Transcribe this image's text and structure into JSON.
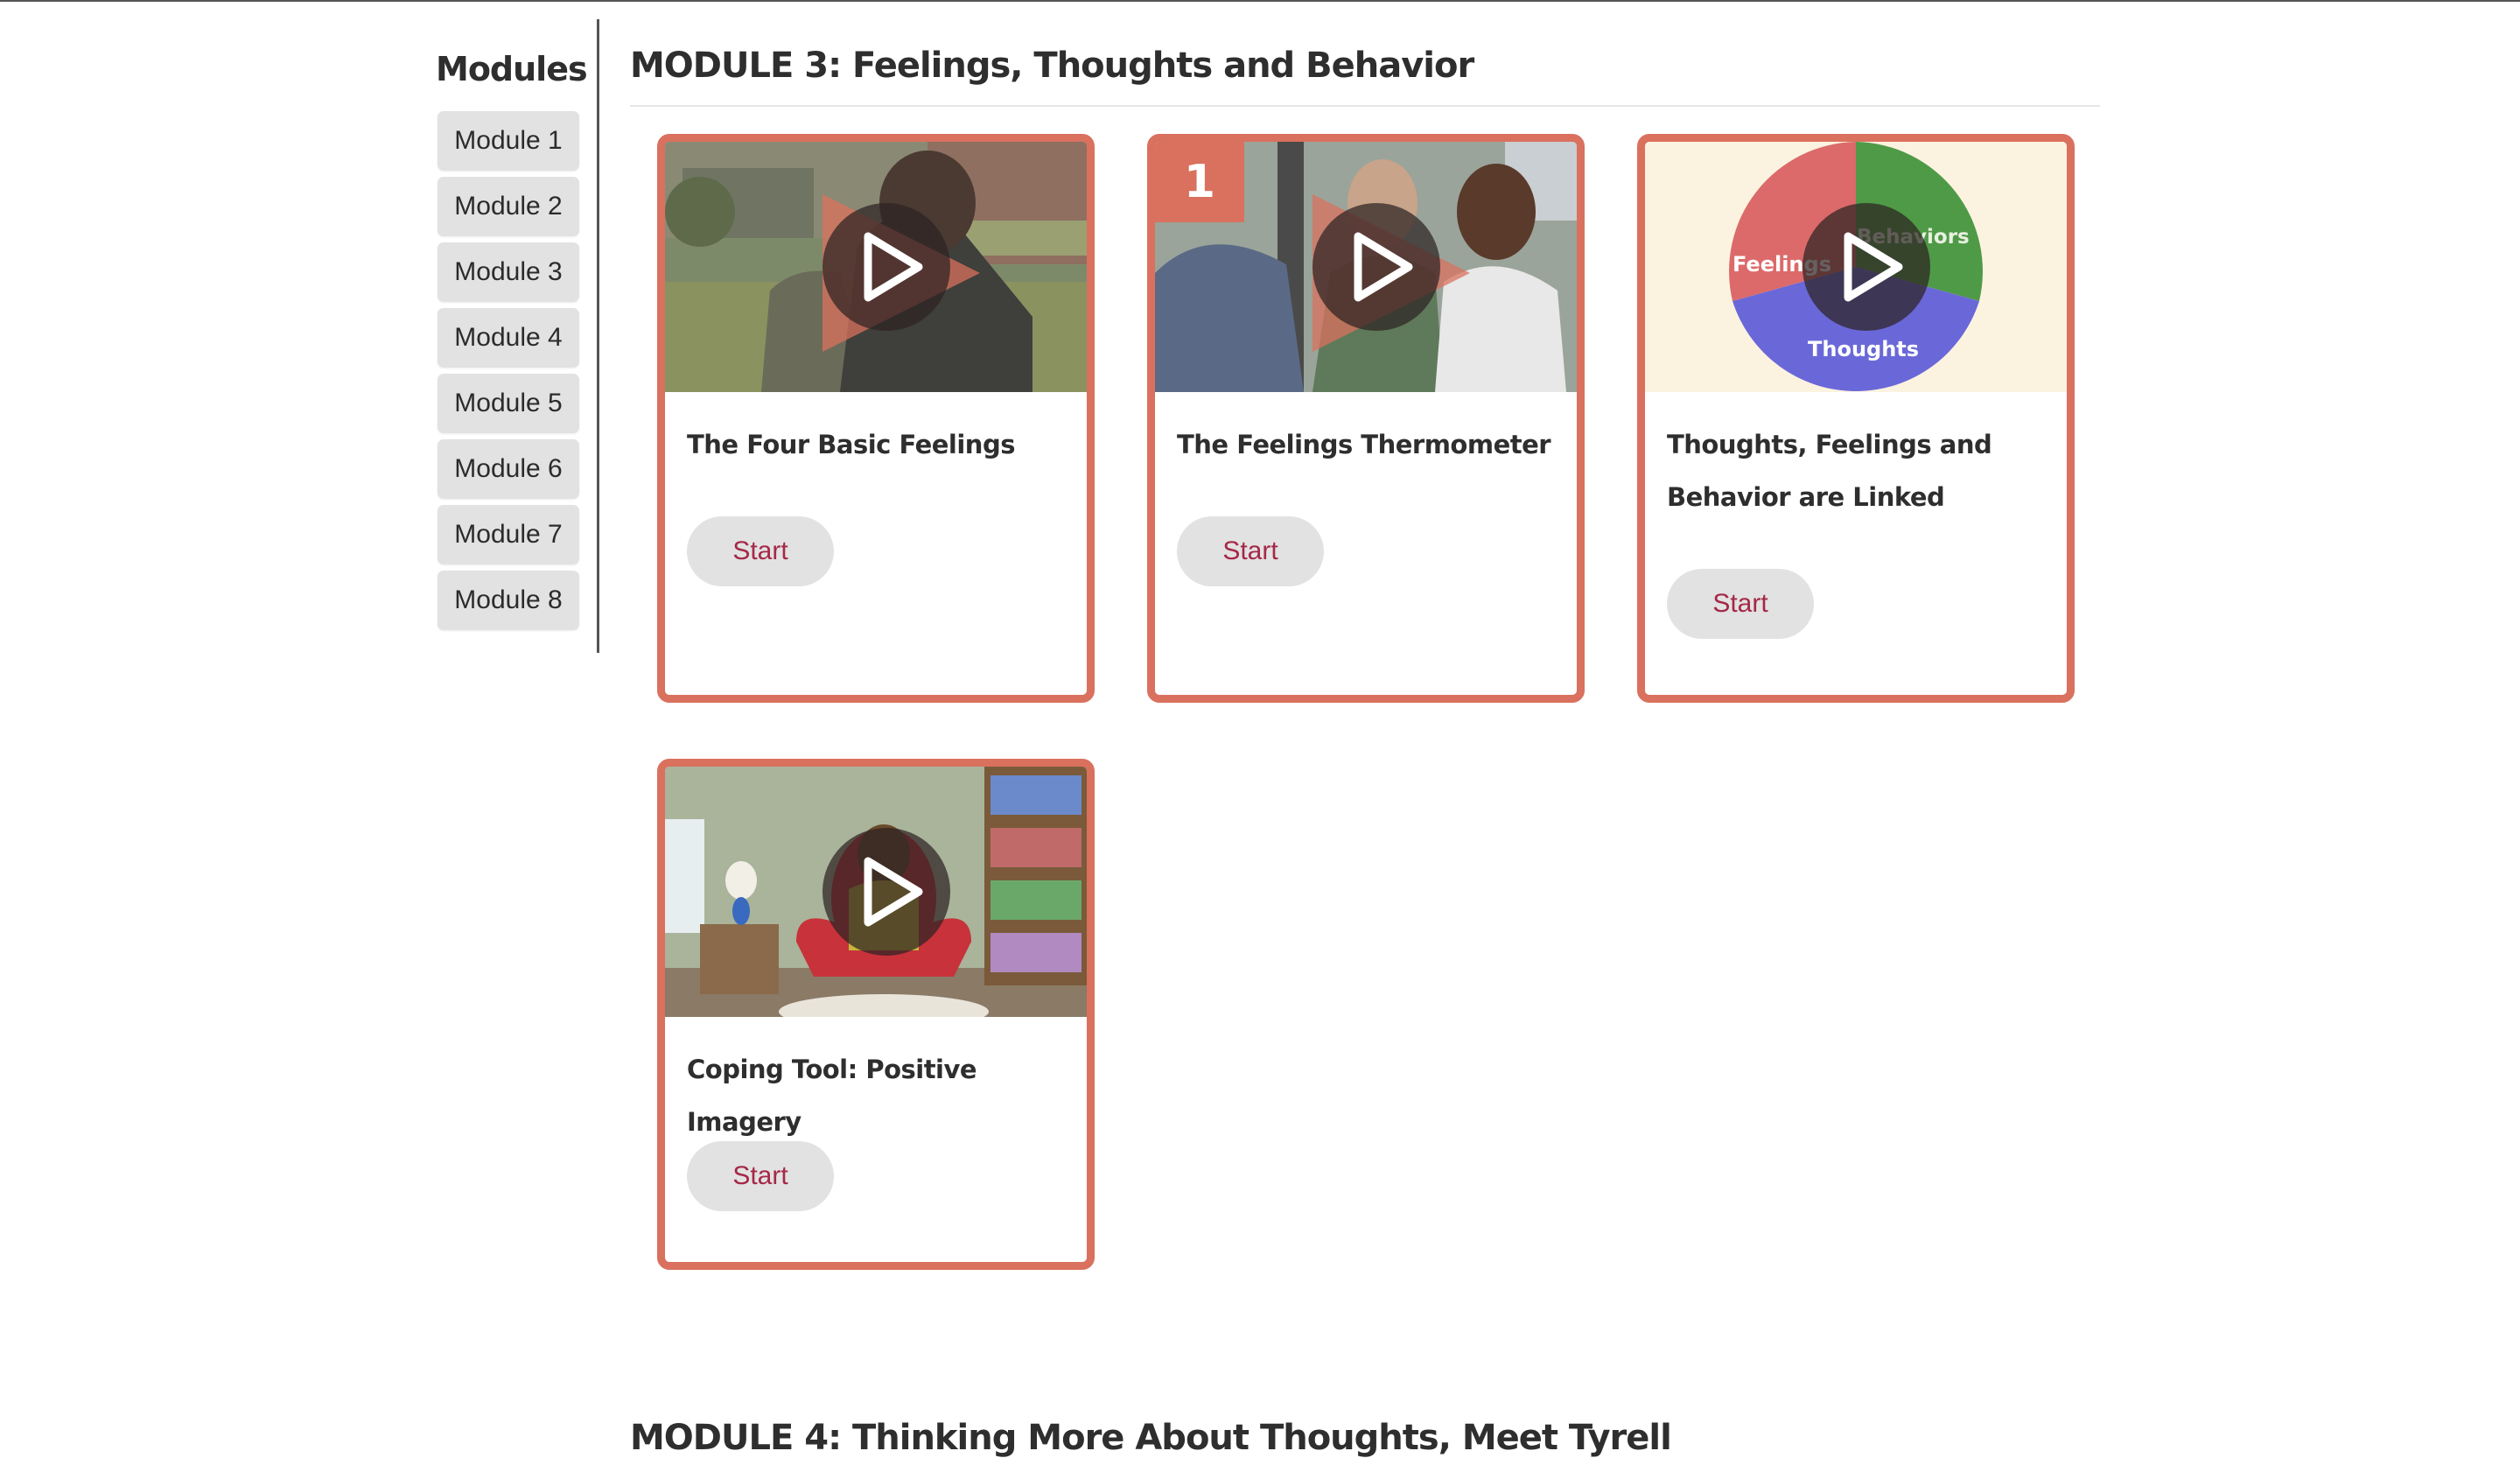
{
  "sidebar": {
    "title": "Modules",
    "items": [
      {
        "label": "Module 1"
      },
      {
        "label": "Module 2"
      },
      {
        "label": "Module 3"
      },
      {
        "label": "Module 4"
      },
      {
        "label": "Module 5"
      },
      {
        "label": "Module 6"
      },
      {
        "label": "Module 7"
      },
      {
        "label": "Module 8"
      }
    ]
  },
  "main": {
    "title": "MODULE 3: Feelings, Thoughts and Behavior",
    "cards": [
      {
        "title": "The Four Basic Feelings",
        "start_label": "Start",
        "thumbnail_icon": "play-icon"
      },
      {
        "title": "The Feelings Thermometer",
        "start_label": "Start",
        "badge": "1",
        "thumbnail_icon": "play-icon"
      },
      {
        "title": "Thoughts, Feelings and Behavior are Linked",
        "start_label": "Start",
        "thumbnail_icon": "play-icon",
        "diagram_labels": {
          "feelings": "Feelings",
          "behaviors": "Behaviors",
          "thoughts": "Thoughts"
        }
      },
      {
        "title": "Coping Tool: Positive Imagery",
        "start_label": "Start",
        "thumbnail_icon": "play-icon"
      }
    ],
    "next_section_title": "MODULE 4: Thinking More About Thoughts, Meet Tyrell"
  },
  "colors": {
    "card_border": "#d9715e",
    "start_text": "#a52848",
    "button_bg": "#e2e2e2"
  }
}
